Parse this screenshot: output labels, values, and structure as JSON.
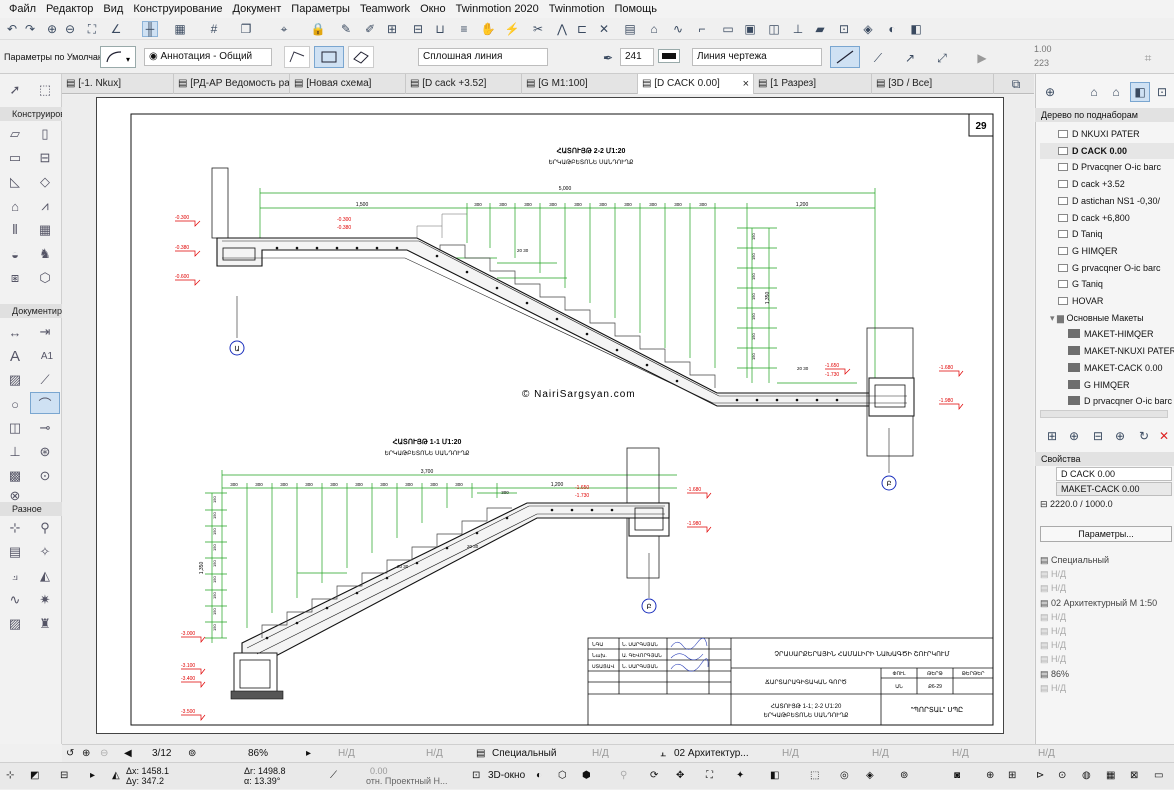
{
  "menu": [
    "Файл",
    "Редактор",
    "Вид",
    "Конструирование",
    "Документ",
    "Параметры",
    "Teamwork",
    "Окно",
    "Twinmotion 2020",
    "Twinmotion",
    "Помощь"
  ],
  "infobox": {
    "defaults_label": "Параметры по Умолчанию",
    "layer_value": "Аннотация - Общий",
    "linetype_value": "Сплошная линия",
    "pen_number": "241",
    "line_category": "Линия чертежа",
    "value_a": "1.00",
    "value_b": "223"
  },
  "tabs": [
    {
      "label": "[-1. Nkux]"
    },
    {
      "label": "[РД-АР Ведомость ра..."
    },
    {
      "label": "[Новая схема]"
    },
    {
      "label": "[D сack +3.52]"
    },
    {
      "label": "[G M1:100]"
    },
    {
      "label": "[D CACK 0.00]",
      "close": "×"
    },
    {
      "label": "[1 Разрез]"
    },
    {
      "label": "[3D / Все]"
    }
  ],
  "toolbox": {
    "section_design": "Конструиров",
    "section_document": "Документир",
    "section_misc": "Разное",
    "a1_label": "A1"
  },
  "navigator": {
    "title": "Дерево по поднаборам",
    "items": [
      {
        "label": "D NKUXI PATER",
        "type": "page"
      },
      {
        "label": "D CACK 0.00",
        "type": "page",
        "bold": true
      },
      {
        "label": "D Prvacqner O-ic barc",
        "type": "page"
      },
      {
        "label": "D сack +3.52",
        "type": "page"
      },
      {
        "label": "D astichan NS1 -0,30/",
        "type": "page"
      },
      {
        "label": "D сack +6,800",
        "type": "page"
      },
      {
        "label": "D Taniq",
        "type": "page"
      },
      {
        "label": "G HIMQER",
        "type": "page"
      },
      {
        "label": "G prvacqner O-ic barc",
        "type": "page"
      },
      {
        "label": "G Taniq",
        "type": "page"
      },
      {
        "label": "HOVAR",
        "type": "page"
      },
      {
        "label": "Основные Макеты",
        "type": "folder"
      },
      {
        "label": "MAKET-HIMQER",
        "type": "layout"
      },
      {
        "label": "MAKET-NKUXI PATER",
        "type": "layout"
      },
      {
        "label": "MAKET-CACK 0.00",
        "type": "layout"
      },
      {
        "label": "G HIMQER",
        "type": "layout"
      },
      {
        "label": "D prvacqner O-ic barc",
        "type": "layout"
      }
    ]
  },
  "properties": {
    "title": "Свойства",
    "name": "D CACK 0.00",
    "layout": "MAKET-CACK 0.00",
    "size": "2220.0 / 1000.0",
    "params_button": "Параметры...",
    "rows": [
      "Специальный",
      "Н/Д",
      "Н/Д",
      "02 Архитектурный М 1:50",
      "Н/Д",
      "Н/Д",
      "Н/Д",
      "Н/Д",
      "86%",
      "Н/Д"
    ]
  },
  "statusbar": {
    "page": "3/12",
    "zoom": "86%",
    "nd1": "Н/Д",
    "nd2": "Н/Д",
    "structure": "Специальный",
    "nd3": "Н/Д",
    "arch_scale": "02 Архитектур...",
    "nd4": "Н/Д",
    "nd5": "Н/Д",
    "nd6": "Н/Д",
    "nd7": "Н/Д"
  },
  "coords": {
    "dx": "Δx: 1458.1",
    "dy": "Δy: 347.2",
    "da": "Δr: 1498.8",
    "angle": "α: 13.39°",
    "zero": "0.00",
    "ref": "отн. Проектный Н...",
    "view3d": "3D-окно"
  },
  "drawing": {
    "sheet_number": "29",
    "section22_title": "ՀԱՏՈՒՅԹ 2-2 Մ1:20",
    "section22_sub": "ԵՐԿԱԹԲԵՏՈՆԵ ՍԱՆԴՈՒՂՔ",
    "section11_title": "ՀԱՏՈՒՅԹ 1-1 Մ1:20",
    "section11_sub": "ԵՐԿԱԹԲԵՏՈՆԵ ՍԱՆԴՈՒՂՔ",
    "dim_total_22": "5,000",
    "dim_left_22": "1,500",
    "dim_right_22": "1,200",
    "dim_step": "300",
    "dim_total_11": "3,700",
    "dim_right_11": "1,200",
    "dim_h_11": "1,350",
    "dim_h_22": "1,350",
    "dim_rise": "150",
    "level_m0300": "-0.300",
    "level_m0380": "-0.380",
    "level_m0600": "-0.600",
    "level_m1650": "-1.650",
    "level_m1730": "-1.730",
    "level_m1680": "-1.680",
    "level_m1980": "-1.980",
    "level_m3000": "-3.000",
    "level_m3100": "-3.100",
    "level_m3400": "-3.400",
    "level_m3500": "-3.500",
    "axis_a": "Ա",
    "axis_b": "Բ",
    "copyright": "©  NairiSargsyan.com",
    "bar_label": "20 30",
    "title_block": {
      "r1c1": "ՆԳԱ",
      "r1c2": "Ն. ՍԱՐԳՍՅԱՆ",
      "r2c1": "Նախ.",
      "r2c2": "Ա. ԳԵՎՈՐԳՅԱՆ",
      "r3c1": "ՍՏԱՑԱՎ",
      "r3c2": "Ն. ՍԱՐԳՍՅԱՆ",
      "project": "ՉՐԱՍԱՐՔԵՐԱՅԻՆ ՀԱՄԱԼԻՐԻ ՆԱԽԱԳԾԻ ՇՈՒՐԿՈՒՄ",
      "part": "ՃԱՐՏԱՐԱԳԻՏԱԿԱՆ ԳՈՐԾ",
      "col_stage": "ՓՈՒԼ",
      "col_sheet": "ԹԵՐԹ",
      "col_sheets": "ԹԵՐԹԵՐ",
      "stage_val": "ԱՆ",
      "sheet_val": "Ք6-29",
      "drawing_name": "ՀԱՏՈՒՅԹ 1-1; 2-2 Մ1:20",
      "drawing_sub": "ԵՐԿԱԹԲԵՏՈՆԵ ՍԱՆԴՈՒՂՔ",
      "company": "\"ՊՈՐՏԱԼ\" ՍՊԸ"
    }
  }
}
